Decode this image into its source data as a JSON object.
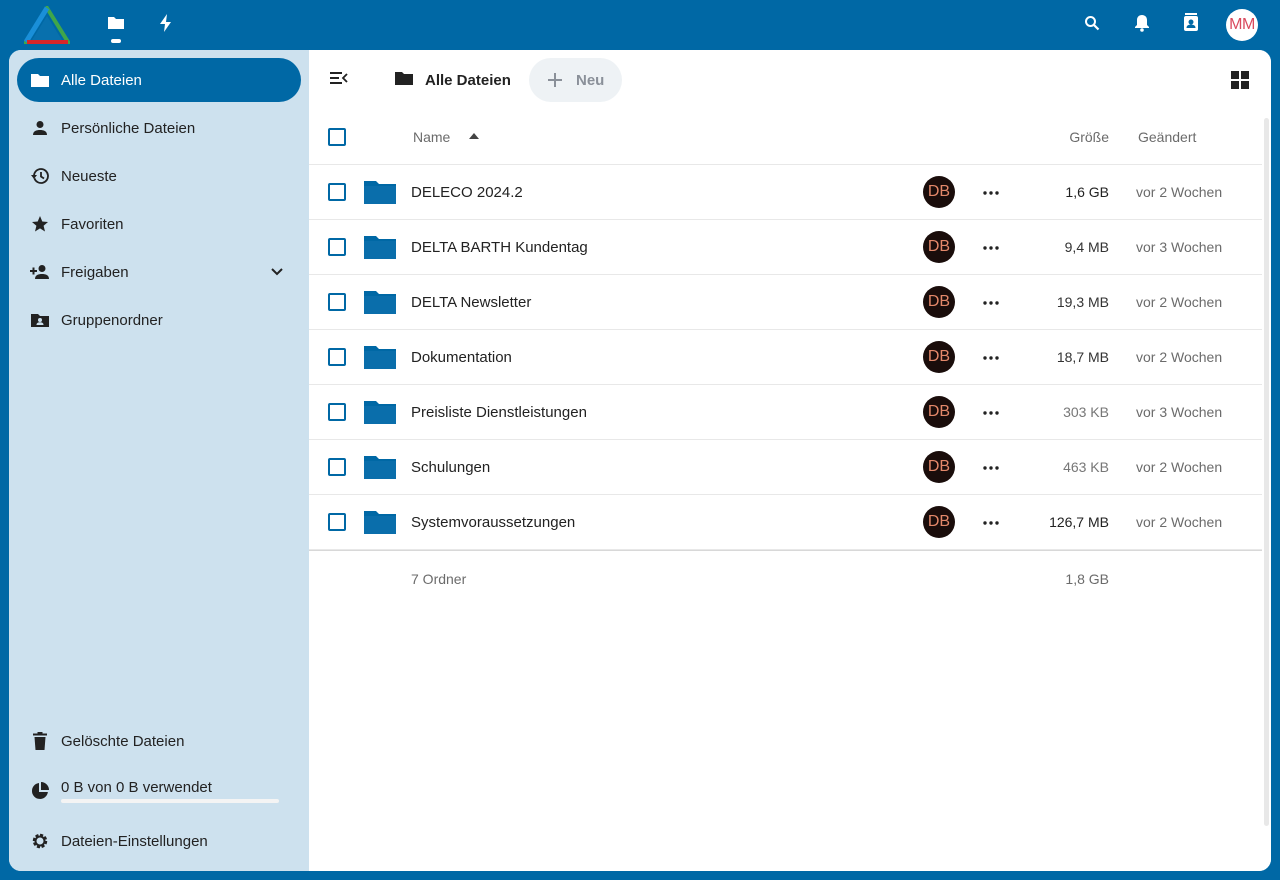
{
  "header": {
    "apps": [
      "files-icon",
      "activity-icon"
    ],
    "avatar_initials": "MM",
    "colors": {
      "brand": "#0068a5",
      "logo_green": "#3fa64a",
      "logo_red": "#d6262a",
      "logo_blue": "#1a8fd8"
    }
  },
  "sidebar": {
    "items": [
      {
        "label": "Alle Dateien",
        "icon": "folder-icon",
        "active": true
      },
      {
        "label": "Persönliche Dateien",
        "icon": "person-icon"
      },
      {
        "label": "Neueste",
        "icon": "history-icon"
      },
      {
        "label": "Favoriten",
        "icon": "star-icon"
      },
      {
        "label": "Freigaben",
        "icon": "share-icon"
      },
      {
        "label": "Gruppenordner",
        "icon": "group-folder-icon"
      }
    ],
    "bottom": {
      "trash": "Gelöschte Dateien",
      "quota": "0 B von 0 B verwendet",
      "quota_fraction": 0,
      "settings": "Dateien-Einstellungen"
    }
  },
  "main": {
    "breadcrumb": "Alle Dateien",
    "new_label": "Neu",
    "columns": {
      "name": "Name",
      "size": "Größe",
      "modified": "Geändert"
    },
    "rows": [
      {
        "name": "DELECO 2024.2",
        "share": "DB",
        "size": "1,6 GB",
        "size_color": "#222222",
        "modified": "vor 2 Wochen"
      },
      {
        "name": "DELTA BARTH Kundentag",
        "share": "DB",
        "size": "9,4 MB",
        "size_color": "#333333",
        "modified": "vor 3 Wochen"
      },
      {
        "name": "DELTA Newsletter",
        "share": "DB",
        "size": "19,3 MB",
        "size_color": "#333333",
        "modified": "vor 2 Wochen"
      },
      {
        "name": "Dokumentation",
        "share": "DB",
        "size": "18,7 MB",
        "size_color": "#333333",
        "modified": "vor 2 Wochen"
      },
      {
        "name": "Preisliste Dienstleistungen",
        "share": "DB",
        "size": "303 KB",
        "size_color": "#777777",
        "modified": "vor 3 Wochen"
      },
      {
        "name": "Schulungen",
        "share": "DB",
        "size": "463 KB",
        "size_color": "#777777",
        "modified": "vor 2 Wochen"
      },
      {
        "name": "Systemvoraussetzungen",
        "share": "DB",
        "size": "126,7 MB",
        "size_color": "#222222",
        "modified": "vor 2 Wochen"
      }
    ],
    "summary": {
      "count": "7 Ordner",
      "total": "1,8 GB"
    }
  }
}
